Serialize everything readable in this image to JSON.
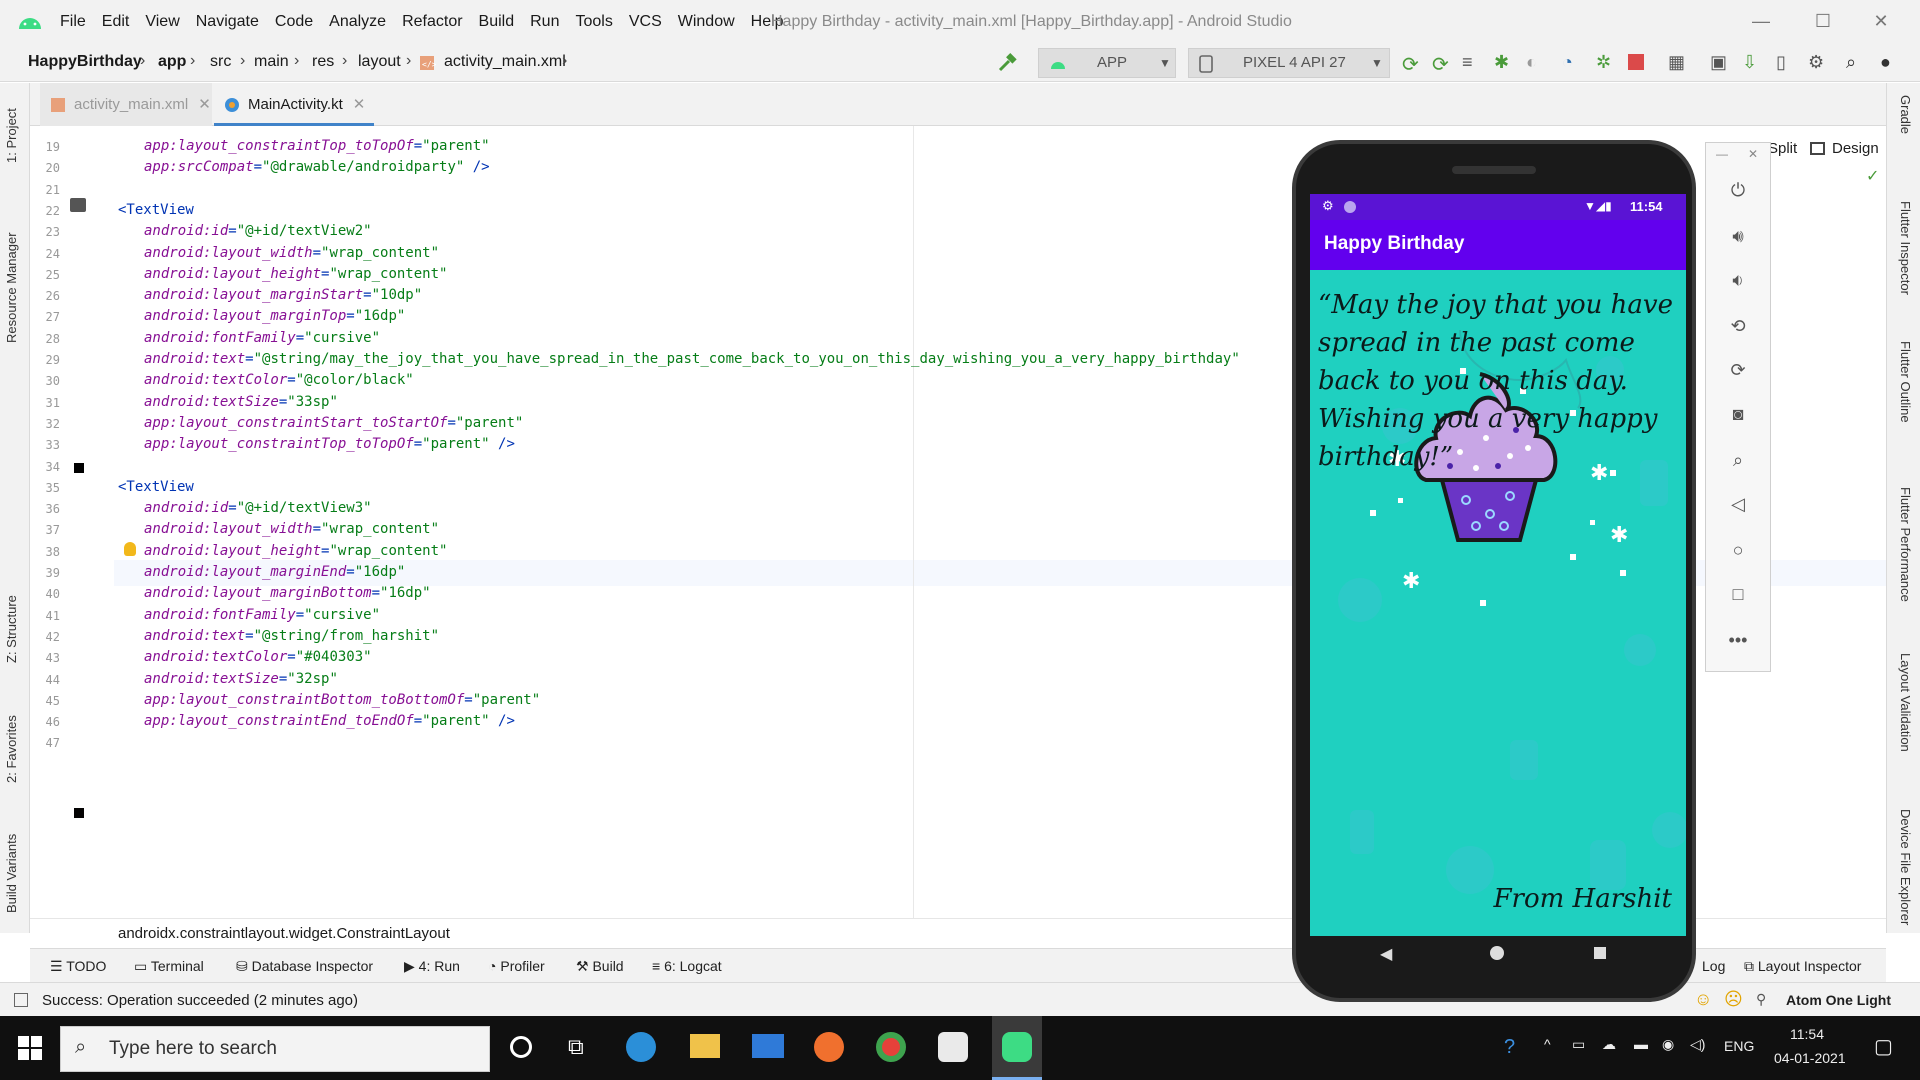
{
  "window": {
    "title": "Happy Birthday - activity_main.xml [Happy_Birthday.app] - Android Studio",
    "menu": [
      "File",
      "Edit",
      "View",
      "Navigate",
      "Code",
      "Analyze",
      "Refactor",
      "Build",
      "Run",
      "Tools",
      "VCS",
      "Window",
      "Help"
    ]
  },
  "breadcrumb": {
    "project": "HappyBirthday",
    "module": "app",
    "items": [
      "src",
      "main",
      "res",
      "layout"
    ],
    "file": "activity_main.xml"
  },
  "toolbar": {
    "run_config": "APP",
    "device": "PIXEL 4 API 27"
  },
  "tabs": [
    {
      "label": "activity_main.xml",
      "active": false
    },
    {
      "label": "MainActivity.kt",
      "active": true
    }
  ],
  "left_tools": [
    "1: Project",
    "Resource Manager",
    "Z: Structure",
    "2: Favorites",
    "Build Variants"
  ],
  "right_tools": [
    "Gradle",
    "Flutter Inspector",
    "Flutter Outline",
    "Flutter Performance",
    "Layout Validation",
    "Device File Explorer"
  ],
  "view_modes": {
    "split": "Split",
    "design": "Design"
  },
  "code_lines": [
    {
      "n": "19",
      "parts": [
        [
          "attr",
          "app:layout_constraintTop_toTopOf"
        ],
        [
          "plain",
          "="
        ],
        [
          "val",
          "\"parent\""
        ]
      ]
    },
    {
      "n": "20",
      "parts": [
        [
          "attr",
          "app:srcCompat"
        ],
        [
          "plain",
          "="
        ],
        [
          "val",
          "\"@drawable/androidparty\""
        ],
        [
          "plain",
          " />"
        ]
      ]
    },
    {
      "n": "21",
      "parts": []
    },
    {
      "n": "22",
      "parts": [
        [
          "tag",
          "<TextView"
        ]
      ],
      "indent": 0
    },
    {
      "n": "23",
      "parts": [
        [
          "attr",
          "android:id"
        ],
        [
          "plain",
          "="
        ],
        [
          "val",
          "\"@+id/textView2\""
        ]
      ]
    },
    {
      "n": "24",
      "parts": [
        [
          "attr",
          "android:layout_width"
        ],
        [
          "plain",
          "="
        ],
        [
          "val",
          "\"wrap_content\""
        ]
      ]
    },
    {
      "n": "25",
      "parts": [
        [
          "attr",
          "android:layout_height"
        ],
        [
          "plain",
          "="
        ],
        [
          "val",
          "\"wrap_content\""
        ]
      ]
    },
    {
      "n": "26",
      "parts": [
        [
          "attr",
          "android:layout_marginStart"
        ],
        [
          "plain",
          "="
        ],
        [
          "val",
          "\"10dp\""
        ]
      ]
    },
    {
      "n": "27",
      "parts": [
        [
          "attr",
          "android:layout_marginTop"
        ],
        [
          "plain",
          "="
        ],
        [
          "val",
          "\"16dp\""
        ]
      ]
    },
    {
      "n": "28",
      "parts": [
        [
          "attr",
          "android:fontFamily"
        ],
        [
          "plain",
          "="
        ],
        [
          "val",
          "\"cursive\""
        ]
      ]
    },
    {
      "n": "29",
      "parts": [
        [
          "attr",
          "android:text"
        ],
        [
          "plain",
          "="
        ],
        [
          "val",
          "\"@string/may_the_joy_that_you_have_spread_in_the_past_come_back_to_you_on_this_day_wishing_you_a_very_happy_birthday\""
        ]
      ]
    },
    {
      "n": "30",
      "parts": [
        [
          "attr",
          "android:textColor"
        ],
        [
          "plain",
          "="
        ],
        [
          "val",
          "\"@color/black\""
        ]
      ]
    },
    {
      "n": "31",
      "parts": [
        [
          "attr",
          "android:textSize"
        ],
        [
          "plain",
          "="
        ],
        [
          "val",
          "\"33sp\""
        ]
      ]
    },
    {
      "n": "32",
      "parts": [
        [
          "attr",
          "app:layout_constraintStart_toStartOf"
        ],
        [
          "plain",
          "="
        ],
        [
          "val",
          "\"parent\""
        ]
      ]
    },
    {
      "n": "33",
      "parts": [
        [
          "attr",
          "app:layout_constraintTop_toTopOf"
        ],
        [
          "plain",
          "="
        ],
        [
          "val",
          "\"parent\""
        ],
        [
          "plain",
          " />"
        ]
      ]
    },
    {
      "n": "34",
      "parts": []
    },
    {
      "n": "35",
      "parts": [
        [
          "tag",
          "<TextView"
        ]
      ],
      "indent": 0
    },
    {
      "n": "36",
      "parts": [
        [
          "attr",
          "android:id"
        ],
        [
          "plain",
          "="
        ],
        [
          "val",
          "\"@+id/textView3\""
        ]
      ]
    },
    {
      "n": "37",
      "parts": [
        [
          "attr",
          "android:layout_width"
        ],
        [
          "plain",
          "="
        ],
        [
          "val",
          "\"wrap_content\""
        ]
      ]
    },
    {
      "n": "38",
      "parts": [
        [
          "attr",
          "android:layout_height"
        ],
        [
          "plain",
          "="
        ],
        [
          "val",
          "\"wrap_content\""
        ]
      ]
    },
    {
      "n": "39",
      "parts": [
        [
          "attr",
          "android:layout_marginEnd"
        ],
        [
          "plain",
          "="
        ],
        [
          "val",
          "\"16dp\""
        ]
      ]
    },
    {
      "n": "40",
      "parts": [
        [
          "attr",
          "android:layout_marginBottom"
        ],
        [
          "plain",
          "="
        ],
        [
          "val",
          "\"16dp\""
        ]
      ]
    },
    {
      "n": "41",
      "parts": [
        [
          "attr",
          "android:fontFamily"
        ],
        [
          "plain",
          "="
        ],
        [
          "val",
          "\"cursive\""
        ]
      ]
    },
    {
      "n": "42",
      "parts": [
        [
          "attr",
          "android:text"
        ],
        [
          "plain",
          "="
        ],
        [
          "val",
          "\"@string/from_harshit\""
        ]
      ]
    },
    {
      "n": "43",
      "parts": [
        [
          "attr",
          "android:textColor"
        ],
        [
          "plain",
          "="
        ],
        [
          "val",
          "\"#040303\""
        ]
      ]
    },
    {
      "n": "44",
      "parts": [
        [
          "attr",
          "android:textSize"
        ],
        [
          "plain",
          "="
        ],
        [
          "val",
          "\"32sp\""
        ]
      ]
    },
    {
      "n": "45",
      "parts": [
        [
          "attr",
          "app:layout_constraintBottom_toBottomOf"
        ],
        [
          "plain",
          "="
        ],
        [
          "val",
          "\"parent\""
        ]
      ]
    },
    {
      "n": "46",
      "parts": [
        [
          "attr",
          "app:layout_constraintEnd_toEndOf"
        ],
        [
          "plain",
          "="
        ],
        [
          "val",
          "\"parent\""
        ],
        [
          "plain",
          " />"
        ]
      ]
    },
    {
      "n": "47",
      "parts": []
    }
  ],
  "editor_breadcrumb": "androidx.constraintlayout.widget.ConstraintLayout",
  "bottom_tools": [
    "TODO",
    "Terminal",
    "Database Inspector",
    "4: Run",
    "Profiler",
    "Build",
    "6: Logcat",
    "Log",
    "Layout Inspector"
  ],
  "status": {
    "message": "Success: Operation succeeded (2 minutes ago)",
    "theme": "Atom One Light"
  },
  "emulator": {
    "time": "11:54",
    "app_title": "Happy Birthday",
    "message": "“May the joy that you have spread in the past come back to you on this day. Wishing you a very happy birthday!”",
    "signature": "From Harshit"
  },
  "taskbar": {
    "search_placeholder": "Type here to search",
    "lang": "ENG",
    "time": "11:54",
    "date": "04-01-2021"
  },
  "colors": {
    "app_bar": "#6200ee",
    "status_bar": "#5a14d4",
    "screen_bg": "#1fd0c0",
    "xml_attr": "#871094",
    "xml_value": "#067d17",
    "xml_tag": "#0033b3"
  }
}
